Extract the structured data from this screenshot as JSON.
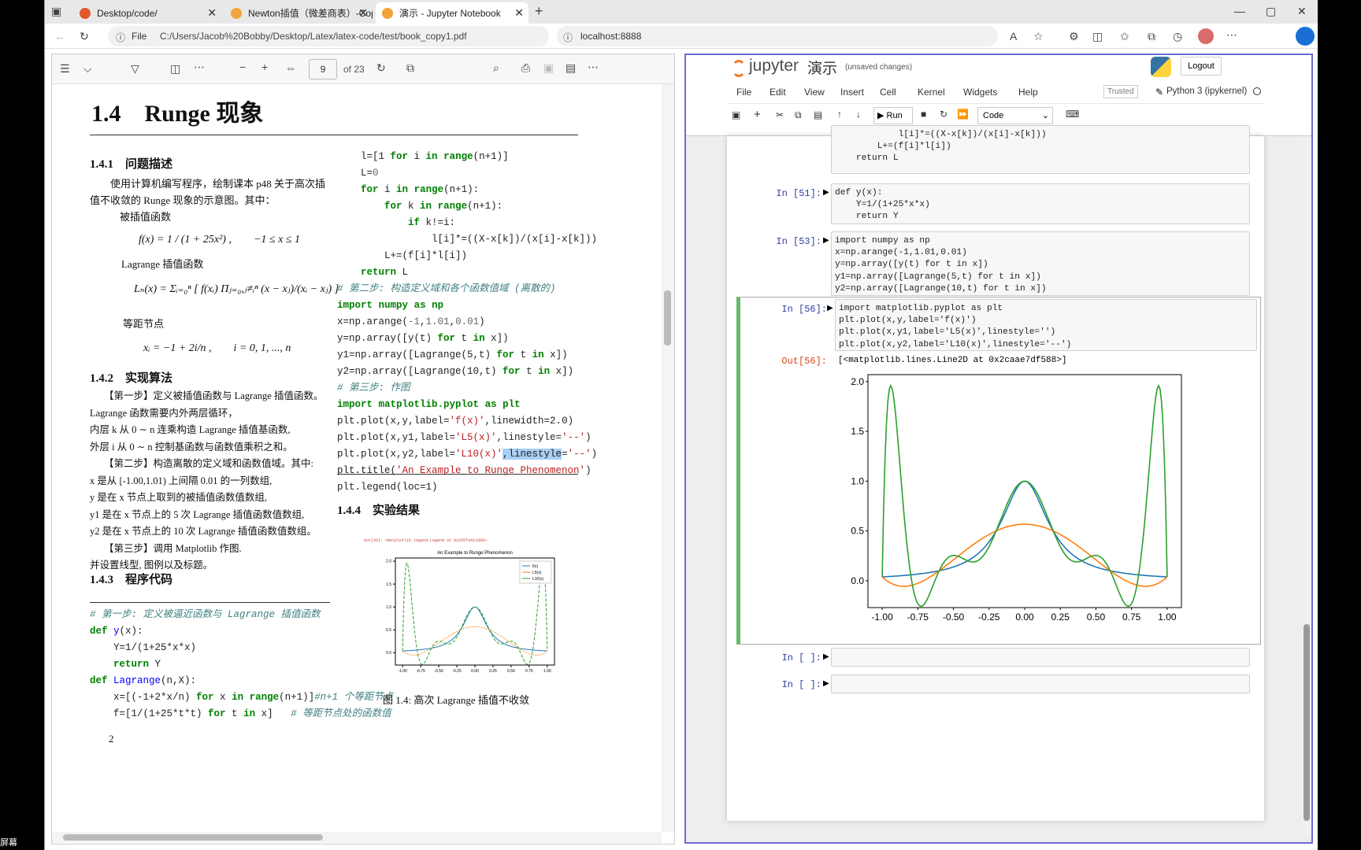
{
  "tabs": [
    {
      "title": "Desktop/code/",
      "color": "#e05a2b"
    },
    {
      "title": "Newton插值（微差商表）-Copy",
      "color": "#f2a33a"
    },
    {
      "title": "演示 - Jupyter Notebook",
      "color": "#f2a33a"
    }
  ],
  "address": {
    "file_label": "File",
    "pdf_path": "C:/Users/Jacob%20Bobby/Desktop/Latex/latex-code/test/book_copy1.pdf",
    "jupyter_url": "localhost:8888"
  },
  "pdf": {
    "page_current": "9",
    "page_total": "of 23",
    "section_title": "1.4　Runge 现象",
    "s1": "1.4.1　问题描述",
    "p1": "使用计算机编写程序，绘制课本 p48 关于高次插值不收敛的 Runge 现象的示意图。其中：",
    "lbl_interp": "被插值函数",
    "f_formula": "f(x) = 1 / (1 + 25x²) ,　　−1 ≤ x ≤ 1",
    "lbl_lagrange": "Lagrange 插值函数",
    "L_formula": "Lₙ(x) = Σᵢ₌₀ⁿ [ f(xᵢ) Πⱼ₌₀,ⱼ≠ᵢⁿ (x − xⱼ)/(xᵢ − xⱼ) ]",
    "lbl_nodes": "等距节点",
    "x_formula": "xᵢ = −1 + 2i/n ,　　i = 0, 1, ..., n",
    "s2": "1.4.2　实现算法",
    "alg": [
      "【第一步】定义被插值函数与 Lagrange 插值函数。",
      "Lagrange 函数需要内外两层循环，",
      "内层 k 从 0 ∼ n 连乘构造 Lagrange 插值基函数,",
      "外层 i 从 0 ∼ n 控制基函数与函数值乘积之和。",
      "【第二步】构造离散的定义域和函数值域。其中:",
      "x 是从 [-1.00,1.01) 上间隔 0.01 的一列数组,",
      "y 是在 x 节点上取到的被插值函数值数组,",
      "y1 是在 x 节点上的 5 次 Lagrange 插值函数值数组,",
      "y2 是在 x 节点上的 10 次 Lagrange 插值函数值数组。",
      "【第三步】调用 Matplotlib 作图.",
      "并设置线型, 图例以及标题。"
    ],
    "s3": "1.4.3　程序代码",
    "s4": "1.4.4　实验结果",
    "fig_caption": "图 1.4: 高次 Lagrange 插值不收敛",
    "fig_title": "An Example to Runge Phenomenon",
    "fig_out": "Out[36]:  <matplotlib.legend.Legend at 0x265fa411d08>",
    "fig_legend": [
      "f(x)",
      "L5(x)",
      "L10(x)"
    ],
    "page_number": "2"
  },
  "jupyter": {
    "logo": "jupyter",
    "title": "演示",
    "status": "(unsaved changes)",
    "logout": "Logout",
    "menu": [
      "File",
      "Edit",
      "View",
      "Insert",
      "Cell",
      "Kernel",
      "Widgets",
      "Help"
    ],
    "trusted": "Trusted",
    "kernel": "Python 3 (ipykernel)",
    "run_label": "Run",
    "celltype": "Code",
    "cells": [
      {
        "prompt": "",
        "code": "            l[i]*=((X-x[k])/(x[i]-x[k]))\n        L+=(f[i]*l[i])\n    return L"
      },
      {
        "prompt": "In [51]:",
        "code": "def y(x):\n    Y=1/(1+25*x*x)\n    return Y"
      },
      {
        "prompt": "In [53]:",
        "code": "import numpy as np\nx=np.arange(-1,1.01,0.01)\ny=np.array([y(t) for t in x])\ny1=np.array([Lagrange(5,t) for t in x])\ny2=np.array([Lagrange(10,t) for t in x])"
      },
      {
        "prompt": "In [56]:",
        "code": "import matplotlib.pyplot as plt\nplt.plot(x,y,label='f(x)')\nplt.plot(x,y1,label='L5(x)',linestyle='')\nplt.plot(x,y2,label='L10(x)',linestyle='--')"
      },
      {
        "prompt": "In [ ]:",
        "code": ""
      },
      {
        "prompt": "In [ ]:",
        "code": ""
      }
    ],
    "out_prompt": "Out[56]:",
    "out_text": "[<matplotlib.lines.Line2D at 0x2caae7df588>]"
  },
  "chart_data": [
    {
      "type": "line",
      "title": "",
      "x_ticks": [
        "-1.00",
        "-0.75",
        "-0.50",
        "-0.25",
        "0.00",
        "0.25",
        "0.50",
        "0.75",
        "1.00"
      ],
      "y_ticks": [
        "0.0",
        "0.5",
        "1.0",
        "1.5",
        "2.0"
      ],
      "xlim": [
        -1.1,
        1.1
      ],
      "ylim": [
        -0.27,
        2.07
      ],
      "series": [
        {
          "name": "f(x)",
          "color": "#1f77b4",
          "style": "solid"
        },
        {
          "name": "L5(x)",
          "color": "#ff7f0e",
          "style": "solid"
        },
        {
          "name": "L10(x)",
          "color": "#2ca02c",
          "style": "solid"
        }
      ]
    },
    {
      "type": "line",
      "title": "An Example to Runge Phenomenon",
      "x_ticks": [
        "-1.00",
        "-0.75",
        "-0.50",
        "-0.25",
        "0.00",
        "0.25",
        "0.50",
        "0.75",
        "1.00"
      ],
      "y_ticks": [
        "0.0",
        "0.5",
        "1.0",
        "1.5",
        "2.0"
      ],
      "xlim": [
        -1.1,
        1.1
      ],
      "ylim": [
        -0.27,
        2.07
      ],
      "series": [
        {
          "name": "f(x)",
          "color": "#1f77b4",
          "style": "solid"
        },
        {
          "name": "L5(x)",
          "color": "#ff7f0e",
          "style": "dotted"
        },
        {
          "name": "L10(x)",
          "color": "#2ca02c",
          "style": "dashed"
        }
      ]
    }
  ],
  "taskbar_text": "屏幕"
}
